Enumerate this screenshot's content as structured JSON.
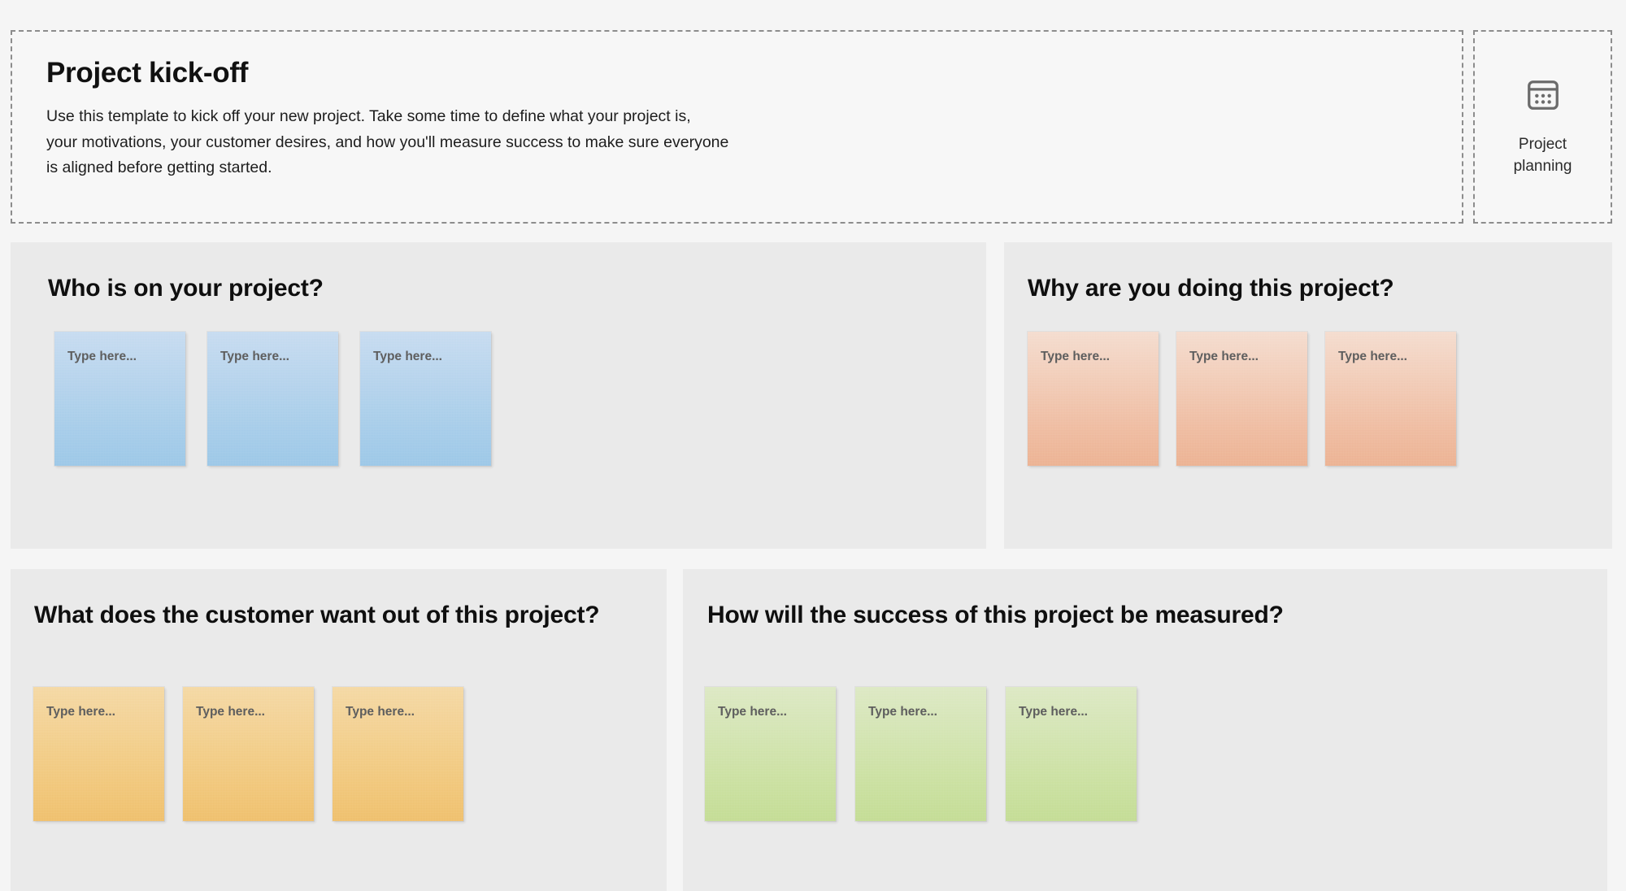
{
  "header": {
    "title": "Project kick-off",
    "description_lines": [
      "Use this template to kick off your new project. Take some time to define what your project is,",
      "your motivations, your customer desires, and how you'll measure success to make sure everyone",
      "is aligned before getting started."
    ]
  },
  "category_tag": {
    "icon": "calendar-icon",
    "label_lines": [
      "Project",
      "planning"
    ]
  },
  "note_placeholder": "Type here...",
  "colors": {
    "page_background": "#f5f5f5",
    "panel_background": "#eaeaea",
    "header_background": "#f7f7f7",
    "dashed_border": "#8d8d8d",
    "note_blue": "#a7cdea",
    "note_peach": "#f0bda2",
    "note_amber": "#f2c87b",
    "note_green": "#cbe1a1",
    "note_text": "#585858",
    "title_text": "#0f0f0f"
  },
  "sections": [
    {
      "id": "who",
      "title": "Who is on your project?",
      "color": "blue",
      "notes": [
        "Type here...",
        "Type here...",
        "Type here..."
      ]
    },
    {
      "id": "why",
      "title": "Why are you doing this project?",
      "color": "peach",
      "notes": [
        "Type here...",
        "Type here...",
        "Type here..."
      ]
    },
    {
      "id": "customer",
      "title": "What does the customer want out of this project?",
      "color": "amber",
      "notes": [
        "Type here...",
        "Type here...",
        "Type here..."
      ]
    },
    {
      "id": "success",
      "title": "How will the success of this project be measured?",
      "color": "green",
      "notes": [
        "Type here...",
        "Type here...",
        "Type here..."
      ]
    }
  ]
}
